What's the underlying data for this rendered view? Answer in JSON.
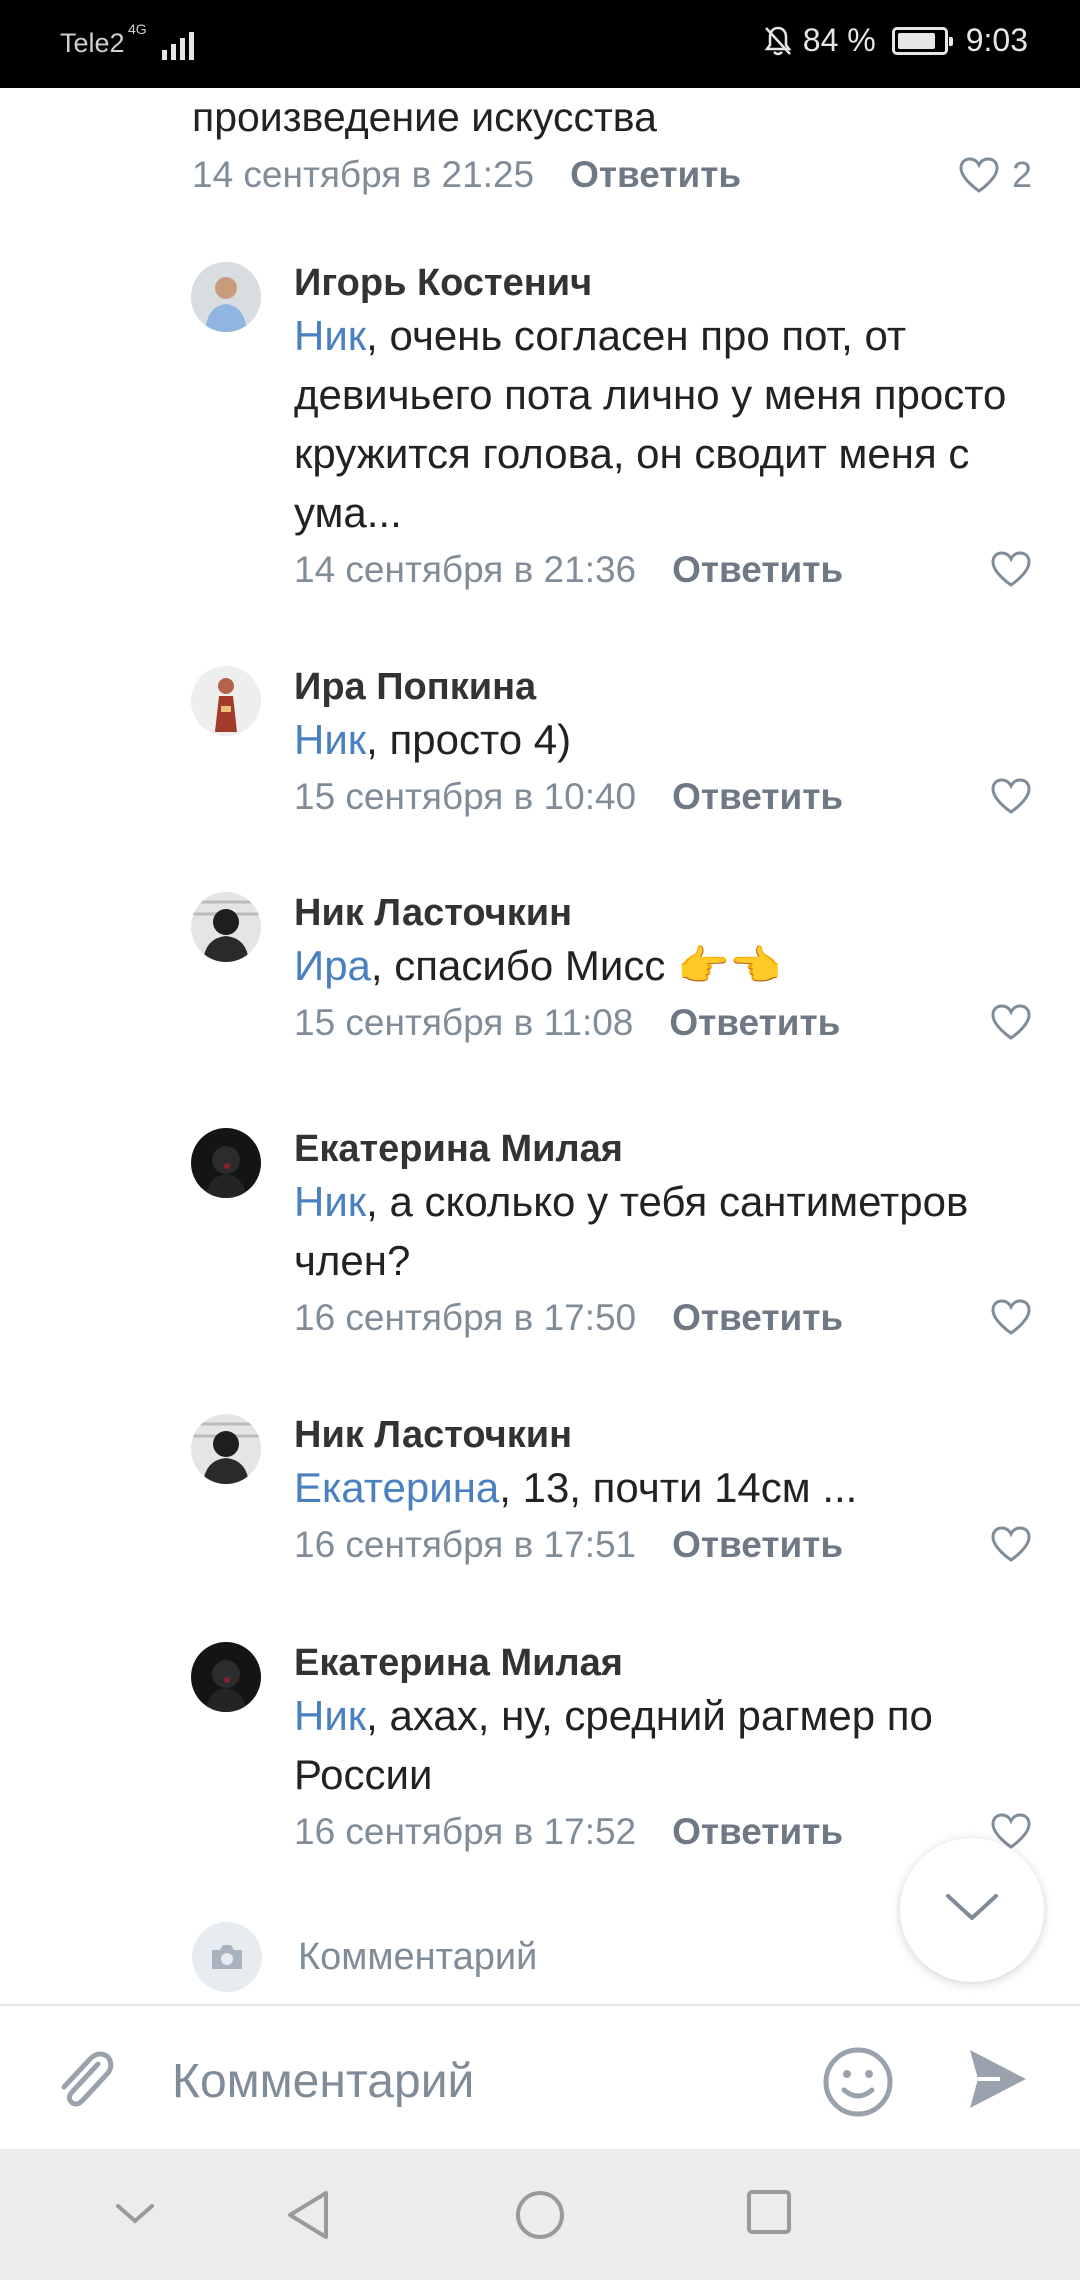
{
  "status_bar": {
    "carrier": "Tele2",
    "network": "4G",
    "battery": "84 %",
    "battery_level": 0.84,
    "time": "9:03"
  },
  "first_comment": {
    "text": "произведение искусства",
    "date": "14 сентября в 21:25",
    "reply": "Ответить",
    "likes": "2"
  },
  "comments": [
    {
      "author": "Игорь Костенич",
      "mention": "Ник",
      "text": ", очень согласен про пот, от девичьего пота лично у меня просто кружится голова, он сводит меня с ума...",
      "date": "14 сентября в 21:36",
      "reply": "Ответить"
    },
    {
      "author": "Ира Попкина",
      "mention": "Ник",
      "text": ", просто 4)",
      "date": "15 сентября в 10:40",
      "reply": "Ответить"
    },
    {
      "author": "Ник Ласточкин",
      "mention": "Ира",
      "text": ", спасибо Мисс 👉👈",
      "date": "15 сентября в 11:08",
      "reply": "Ответить"
    },
    {
      "author": "Екатерина Милая",
      "mention": "Ник",
      "text": ", а сколько у тебя сантиметров член?",
      "date": "16 сентября в 17:50",
      "reply": "Ответить"
    },
    {
      "author": "Ник Ласточкин",
      "mention": "Екатерина",
      "text": ", 13, почти 14см ...",
      "date": "16 сентября в 17:51",
      "reply": "Ответить"
    },
    {
      "author": "Екатерина Милая",
      "mention": "Ник",
      "text": ", ахах, ну, средний рагмер по России",
      "date": "16 сентября в 17:52",
      "reply": "Ответить"
    }
  ],
  "mini_comment": {
    "placeholder": "Комментарий"
  },
  "input_bar": {
    "placeholder": "Комментарий"
  },
  "colors": {
    "mention": "#4a80c0",
    "meta": "#818c99",
    "status_bar_bg": "#000000",
    "nav_bar_bg": "#ececec"
  },
  "icons": [
    "signal-icon",
    "bell-off-icon",
    "battery-icon",
    "heart-icon",
    "chevron-down-icon",
    "camera-icon",
    "paperclip-icon",
    "emoji-icon",
    "send-icon",
    "nav-back-icon",
    "nav-home-icon",
    "nav-recents-icon",
    "nav-hide-icon"
  ]
}
